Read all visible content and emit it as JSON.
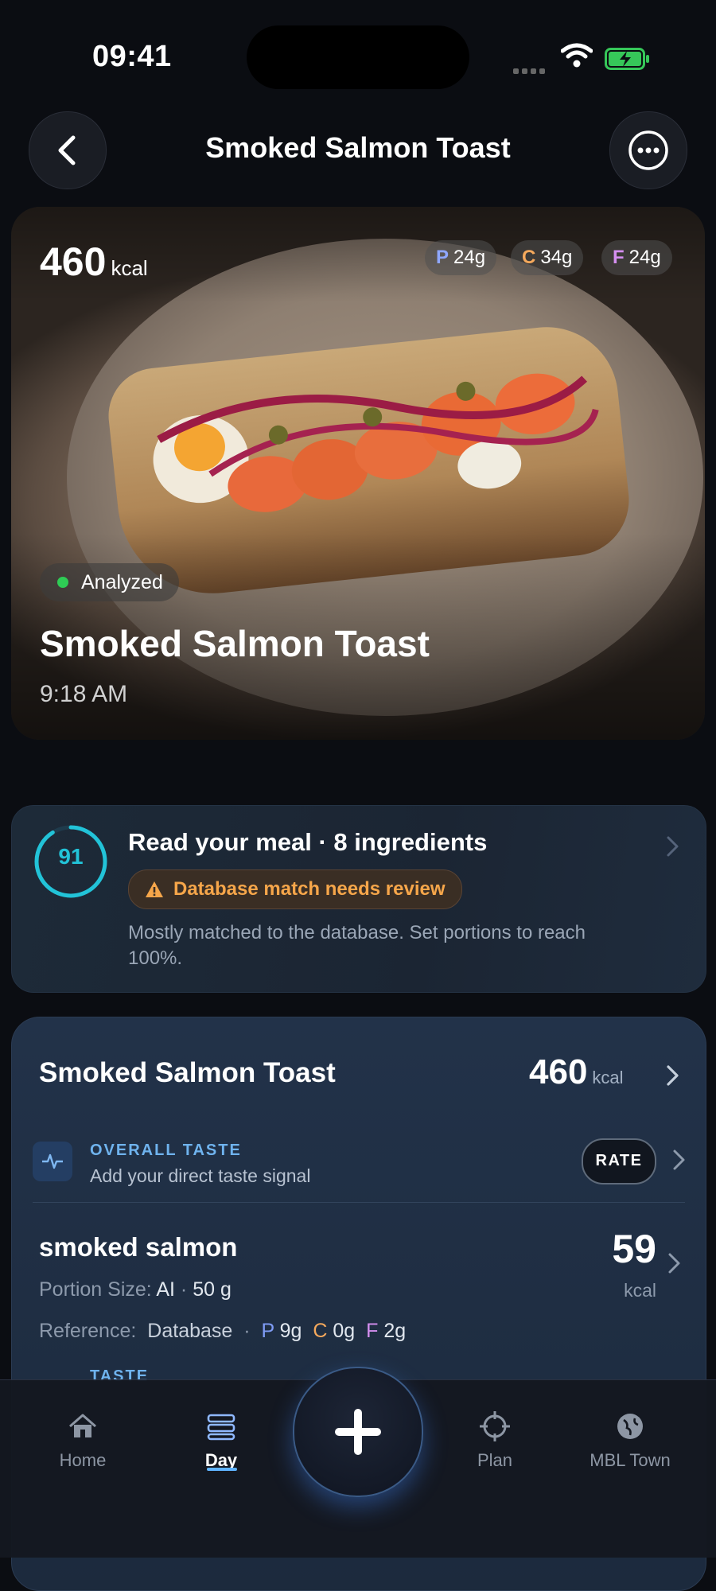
{
  "status_bar": {
    "time": "09:41"
  },
  "header": {
    "title": "Smoked Salmon Toast"
  },
  "hero": {
    "kcal": "460",
    "kcal_unit": "kcal",
    "macros": [
      {
        "letter": "P",
        "value": "24g",
        "color": "#8fa7ff"
      },
      {
        "letter": "C",
        "value": "34g",
        "color": "#f5a95c"
      },
      {
        "letter": "F",
        "value": "24g",
        "color": "#d58ff0"
      }
    ],
    "status": "Analyzed",
    "meal_name": "Smoked Salmon Toast",
    "time": "9:18 AM"
  },
  "read_card": {
    "score": "91",
    "score_fraction": 0.91,
    "title": "Read your meal · 8 ingredients",
    "warning": "Database match needs review",
    "description": "Mostly matched to the database. Set portions to reach 100%."
  },
  "detail_card": {
    "title": "Smoked Salmon Toast",
    "kcal": "460",
    "kcal_unit": "kcal",
    "overall_taste_label": "OVERALL TASTE",
    "overall_taste_sub": "Add your direct taste signal",
    "rate_label": "RATE",
    "ingredient": {
      "name": "smoked salmon",
      "kcal": "59",
      "kcal_unit": "kcal",
      "portion_label": "Portion Size:",
      "portion_source": "AI",
      "portion_dot": "·",
      "portion_value": "50 g",
      "reference_label": "Reference:",
      "reference_value": "Database",
      "reference_dot": "·",
      "macros": [
        {
          "letter": "P",
          "value": "9g"
        },
        {
          "letter": "C",
          "value": "0g"
        },
        {
          "letter": "F",
          "value": "2g"
        }
      ],
      "taste_label": "TASTE"
    }
  },
  "bottom_nav": {
    "items": [
      {
        "label": "Home",
        "icon": "home-icon"
      },
      {
        "label": "Day",
        "icon": "day-icon",
        "active": true
      },
      {
        "label": "Plan",
        "icon": "crosshair-icon"
      },
      {
        "label": "MBL Town",
        "icon": "globe-icon"
      }
    ],
    "fab_icon": "plus-icon"
  },
  "colors": {
    "background": "#0b0d12",
    "accent_cyan": "#22c3d8",
    "warning": "#f6a64a",
    "analyzed_dot": "#2ecc55"
  }
}
